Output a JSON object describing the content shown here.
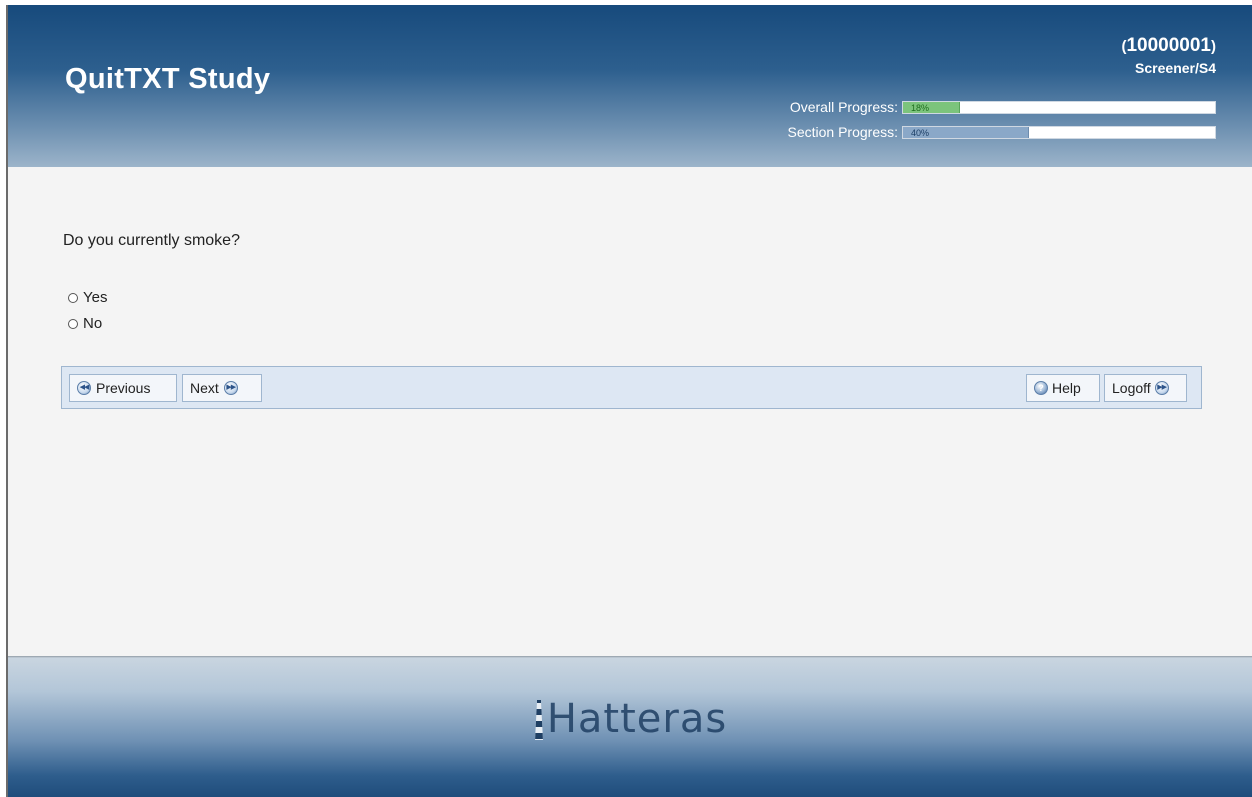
{
  "header": {
    "title": "QuitTXT Study",
    "participant_id": "10000001",
    "paren_open": "(",
    "paren_close": ")",
    "section": "Screener/S4",
    "overall_progress": {
      "label": "Overall Progress:",
      "percent": 18,
      "text": "18%"
    },
    "section_progress": {
      "label": "Section Progress:",
      "percent": 40,
      "text": "40%"
    },
    "colors": {
      "header_top": "#174a7c",
      "overall_fill": "#7cc47c",
      "section_fill": "#8aa8c8"
    }
  },
  "question": {
    "text": "Do you currently smoke?",
    "options": [
      {
        "label": "Yes",
        "selected": false
      },
      {
        "label": "No",
        "selected": false
      }
    ]
  },
  "nav": {
    "previous_label": "Previous",
    "previous_icon": "rewind-icon",
    "next_label": "Next",
    "next_icon": "fast-forward-icon",
    "help_label": "Help",
    "help_icon": "help-icon",
    "logoff_label": "Logoff",
    "logoff_icon": "fast-forward-icon"
  },
  "footer": {
    "logo_text": "Hatteras",
    "logo_icon": "lighthouse-icon"
  }
}
